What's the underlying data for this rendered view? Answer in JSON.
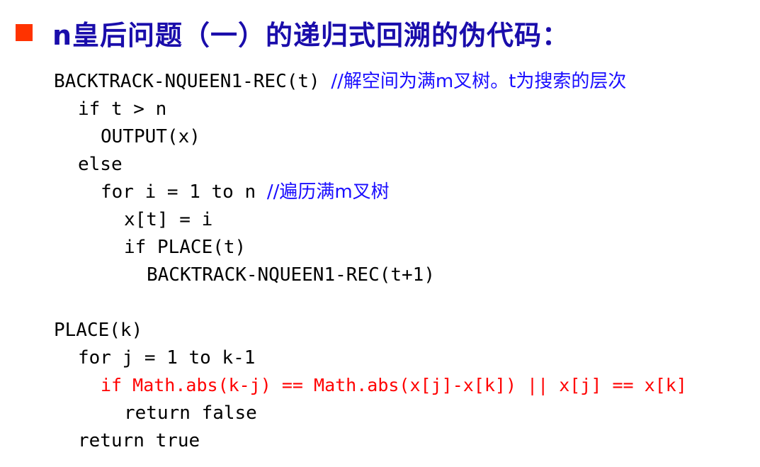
{
  "title": {
    "bullet_color": "#ff3300",
    "text": "n皇后问题（一）的递归式回溯的伪代码："
  },
  "code": {
    "lines": [
      {
        "code": "BACKTRACK-NQUEEN1-REC(t) ",
        "comment": "//解空间为满m叉树。t为搜索的层次"
      },
      {
        "code": "if t > n",
        "comment": ""
      },
      {
        "code": "OUTPUT(x)",
        "comment": ""
      },
      {
        "code": "else",
        "comment": ""
      },
      {
        "code": "for i = 1 to n ",
        "comment": "//遍历满m叉树"
      },
      {
        "code": "x[t] = i",
        "comment": ""
      },
      {
        "code": "if PLACE(t)",
        "comment": ""
      },
      {
        "code": "BACKTRACK-NQUEEN1-REC(t+1)",
        "comment": ""
      },
      {
        "code": "PLACE(k)",
        "comment": ""
      },
      {
        "code": "for j = 1 to k-1",
        "comment": ""
      },
      {
        "code": "if Math.abs(k-j) == Math.abs(x[j]-x[k]) || x[j] == x[k]",
        "comment": ""
      },
      {
        "code": "return false",
        "comment": ""
      },
      {
        "code": "return true",
        "comment": ""
      }
    ]
  },
  "colors": {
    "title": "#1a0dab",
    "comment": "#1a0dff",
    "highlight": "#ff0000",
    "code": "#000000"
  }
}
